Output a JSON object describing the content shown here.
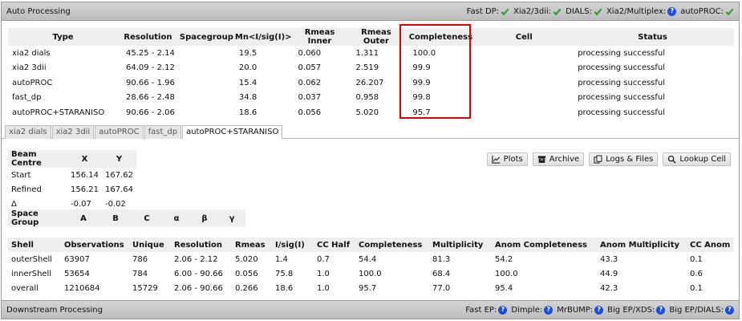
{
  "auto_panel": {
    "title": "Auto Processing",
    "status": [
      {
        "label": "Fast DP:",
        "state": "ok"
      },
      {
        "label": "Xia2/3dii:",
        "state": "ok"
      },
      {
        "label": "DIALS:",
        "state": "ok"
      },
      {
        "label": "Xia2/Multiplex:",
        "state": "unknown"
      },
      {
        "label": "autoPROC:",
        "state": "ok"
      }
    ]
  },
  "summary": {
    "headers": [
      "Type",
      "Resolution",
      "Spacegroup",
      "Mn<I/sig(I)>",
      "Rmeas Inner",
      "Rmeas Outer",
      "Completeness",
      "Cell",
      "Status"
    ],
    "rows": [
      [
        "xia2 dials",
        "45.25 - 2.14",
        "",
        "19.5",
        "0.060",
        "1.311",
        "100.0",
        "",
        "processing successful"
      ],
      [
        "xia2 3dii",
        "64.09 - 2.12",
        "",
        "20.0",
        "0.057",
        "2.519",
        "99.9",
        "",
        "processing successful"
      ],
      [
        "autoPROC",
        "90.66 - 1.96",
        "",
        "15.4",
        "0.062",
        "26.207",
        "99.9",
        "",
        "processing successful"
      ],
      [
        "fast_dp",
        "28.66 - 2.48",
        "",
        "34.8",
        "0.037",
        "0.958",
        "99.8",
        "",
        "processing successful"
      ],
      [
        "autoPROC+STARANISO",
        "90.66 - 2.06",
        "",
        "18.6",
        "0.056",
        "5.020",
        "95.7",
        "",
        "processing successful"
      ]
    ]
  },
  "tabs": [
    "xia2 dials",
    "xia2 3dii",
    "autoPROC",
    "fast_dp",
    "autoPROC+STARANISO"
  ],
  "active_tab": 4,
  "beam": {
    "header": [
      "Beam Centre",
      "X",
      "Y"
    ],
    "rows": [
      [
        "Start",
        "156.14",
        "167.62"
      ],
      [
        "Refined",
        "156.21",
        "167.64"
      ],
      [
        "Δ",
        "-0.07",
        "-0.02"
      ]
    ],
    "spacegroup_header": [
      "Space Group",
      "A",
      "B",
      "C",
      "α",
      "β",
      "γ"
    ]
  },
  "buttons": {
    "plots": "Plots",
    "archive": "Archive",
    "logs": "Logs & Files",
    "lookup": "Lookup Cell"
  },
  "shells": {
    "headers": [
      "Shell",
      "Observations",
      "Unique",
      "Resolution",
      "Rmeas",
      "I/sig(I)",
      "CC Half",
      "Completeness",
      "Multiplicity",
      "Anom Completeness",
      "Anom Multiplicity",
      "CC Anom"
    ],
    "rows": [
      [
        "outerShell",
        "63907",
        "786",
        "2.06 - 2.12",
        "5.020",
        "1.4",
        "0.7",
        "54.4",
        "81.3",
        "54.2",
        "43.3",
        "0.1"
      ],
      [
        "innerShell",
        "53654",
        "784",
        "6.00 - 90.66",
        "0.056",
        "75.8",
        "1.0",
        "100.0",
        "68.4",
        "100.0",
        "44.9",
        "0.6"
      ],
      [
        "overall",
        "1210684",
        "15729",
        "2.06 - 90.66",
        "0.266",
        "18.6",
        "1.0",
        "95.7",
        "77.0",
        "95.4",
        "42.3",
        "0.1"
      ]
    ]
  },
  "downstream_panel": {
    "title": "Downstream Processing",
    "status": [
      {
        "label": "Fast EP:",
        "state": "unknown"
      },
      {
        "label": "Dimple:",
        "state": "unknown"
      },
      {
        "label": "MrBUMP:",
        "state": "unknown"
      },
      {
        "label": "Big EP/XDS:",
        "state": "unknown"
      },
      {
        "label": "Big EP/DIALS:",
        "state": "unknown"
      }
    ]
  },
  "colors": {
    "ok": "#2e9e2e",
    "unknown": "#1d4fd8",
    "highlight": "#e00000",
    "header_bg": "#eeeeee"
  }
}
